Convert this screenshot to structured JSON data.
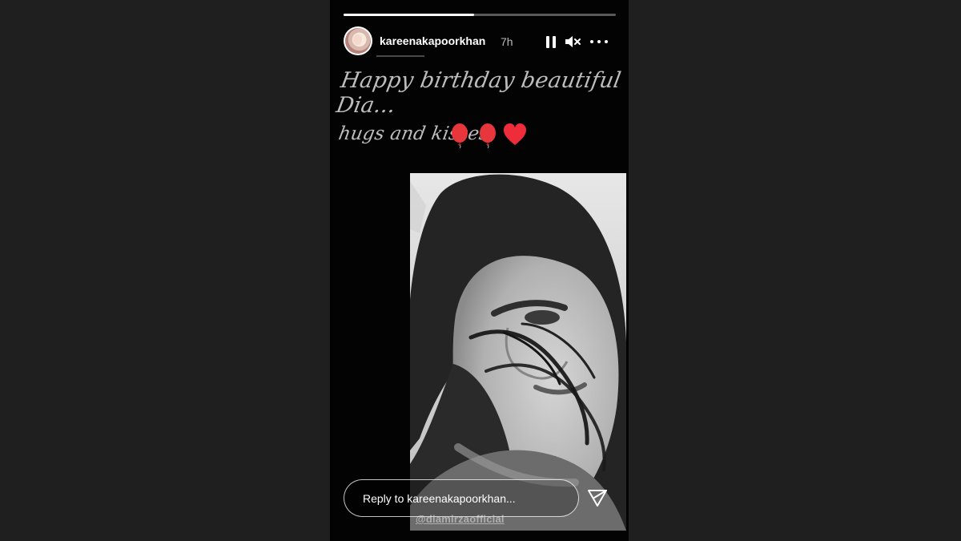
{
  "story": {
    "username": "kareenakapoorkhan",
    "time": "7h",
    "progress_fraction": 0.48,
    "caption_line1": "Happy birthday beautiful Dia...",
    "caption_line2": "hugs and kisses",
    "caption_emojis": [
      "balloon",
      "balloon",
      "red-heart"
    ],
    "mention": "@diamirzaofficial",
    "reply_placeholder": "Reply to kareenakapoorkhan..."
  },
  "icons": {
    "pause": "pause-icon",
    "mute": "muted-speaker-icon",
    "more": "more-options-icon",
    "send": "send-icon"
  },
  "colors": {
    "page_background": "#1f1f1f",
    "story_background": "#030303",
    "accent_red": "#e8363d"
  }
}
